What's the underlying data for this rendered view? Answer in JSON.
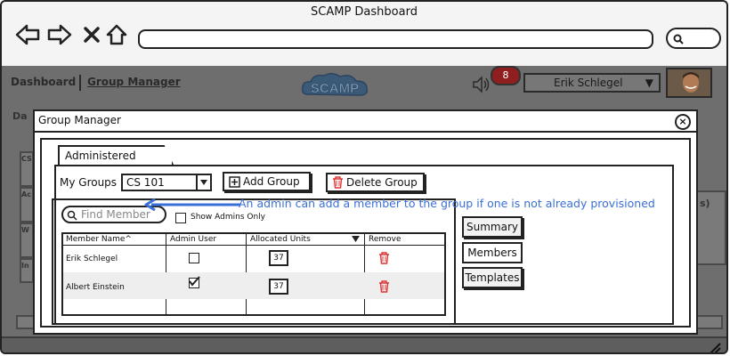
{
  "browser": {
    "title": "SCAMP Dashboard",
    "nav_icons": [
      "back-arrow-icon",
      "forward-arrow-icon",
      "close-x-icon",
      "home-icon"
    ]
  },
  "appnav": {
    "links": [
      "Dashboard",
      "Group Manager"
    ],
    "logo_text": "SCAMP",
    "notification_count": "8",
    "user_name": "Erik Schlegel",
    "user_arrow": "▼"
  },
  "background": {
    "labels": [
      "Da",
      "CS",
      "Ac",
      "W",
      "In",
      "s)"
    ]
  },
  "modal": {
    "title": "Group Manager",
    "close_symbol": "×",
    "tab_label": "Administered Groups",
    "my_groups_label": "My Groups",
    "selected_group": "CS 101",
    "add_group_label": "Add Group",
    "delete_group_label": "Delete Group",
    "find_placeholder": "Find Member",
    "show_admins_label": "Show Admins Only",
    "columns": [
      "Member Name^",
      "Admin User",
      "Allocated Units",
      "Remove"
    ],
    "rows": [
      {
        "name": "Erik Schlegel",
        "admin": false,
        "units": "37"
      },
      {
        "name": "Albert Einstein",
        "admin": true,
        "units": "37"
      }
    ],
    "side_buttons": [
      "Summary",
      "Members",
      "Templates"
    ],
    "annotation": "An admin can add a member to the group if one is not already provisioned"
  },
  "colors": {
    "annotation": "#3a6fd8",
    "remove_icon": "#d33",
    "notif_badge": "#8f1e1e"
  }
}
